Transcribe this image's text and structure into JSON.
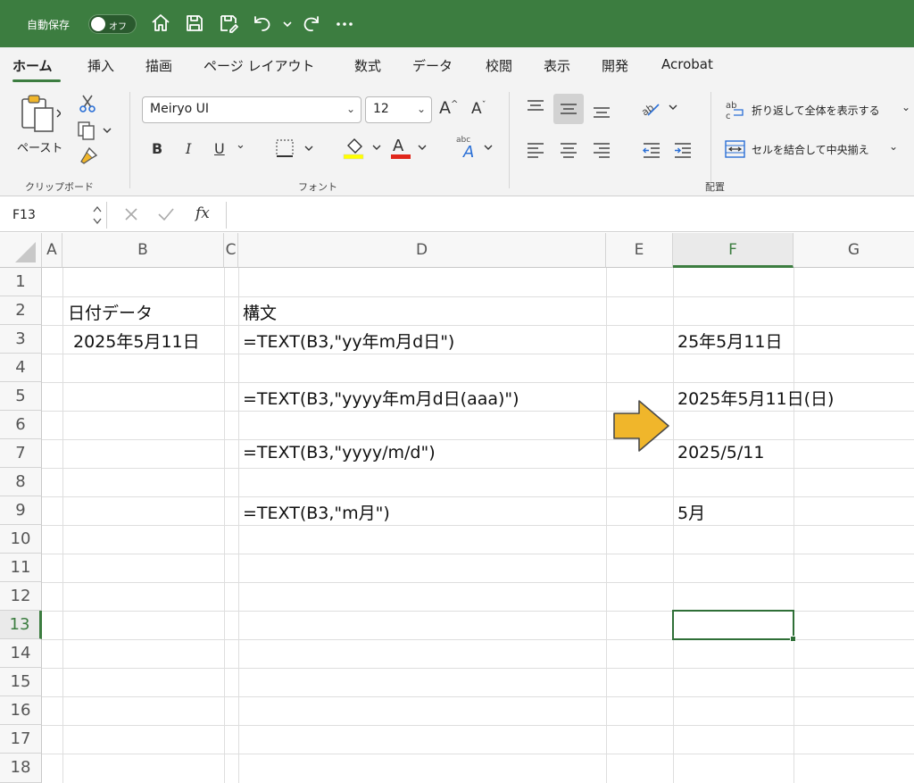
{
  "titlebar": {
    "autosave_label": "自動保存",
    "autosave_state": "オフ",
    "icons": [
      "home-icon",
      "save-icon",
      "save-as-icon",
      "undo-icon",
      "redo-icon",
      "more-icon"
    ],
    "background": "#3c7d40"
  },
  "tabs": [
    {
      "label": "ホーム",
      "active": true
    },
    {
      "label": "挿入"
    },
    {
      "label": "描画"
    },
    {
      "label": "ページ レイアウト"
    },
    {
      "label": "数式"
    },
    {
      "label": "データ"
    },
    {
      "label": "校閲"
    },
    {
      "label": "表示"
    },
    {
      "label": "開発"
    },
    {
      "label": "Acrobat"
    }
  ],
  "ribbon": {
    "paste_label": "ペースト",
    "clipboard_group": "クリップボード",
    "font_group": "フォント",
    "alignment_group": "配置",
    "font_name": "Meiryo UI",
    "font_size": "12",
    "bold": "B",
    "italic": "I",
    "underline": "U",
    "wrap_text": "折り返して全体を表示する",
    "merge_center": "セルを結合して中央揃え",
    "fill_color": "#ffff00",
    "font_color": "#e0261b"
  },
  "formula_bar": {
    "name_box": "F13",
    "fx": "fx",
    "formula": ""
  },
  "grid": {
    "columns": [
      "A",
      "B",
      "C",
      "D",
      "E",
      "F",
      "G"
    ],
    "active_column": "F",
    "rows": [
      "1",
      "2",
      "3",
      "4",
      "5",
      "6",
      "7",
      "8",
      "9",
      "10",
      "11",
      "12",
      "13",
      "14",
      "15",
      "16",
      "17",
      "18"
    ],
    "active_row": "13",
    "cells": {
      "B2": "日付データ",
      "B3": "2025年5月11日",
      "D2": "構文",
      "D3": "=TEXT(B3,\"yy年m月d日\")",
      "F3": "25年5月11日",
      "D5": "=TEXT(B3,\"yyyy年m月d日(aaa)\")",
      "F5": "2025年5月11日(日)",
      "D7": "=TEXT(B3,\"yyyy/m/d\")",
      "F7": "2025/5/11",
      "D9": "=TEXT(B3,\"m月\")",
      "F9": "5月"
    },
    "selected_cell": "F13",
    "arrow_color": "#f0b62b"
  }
}
